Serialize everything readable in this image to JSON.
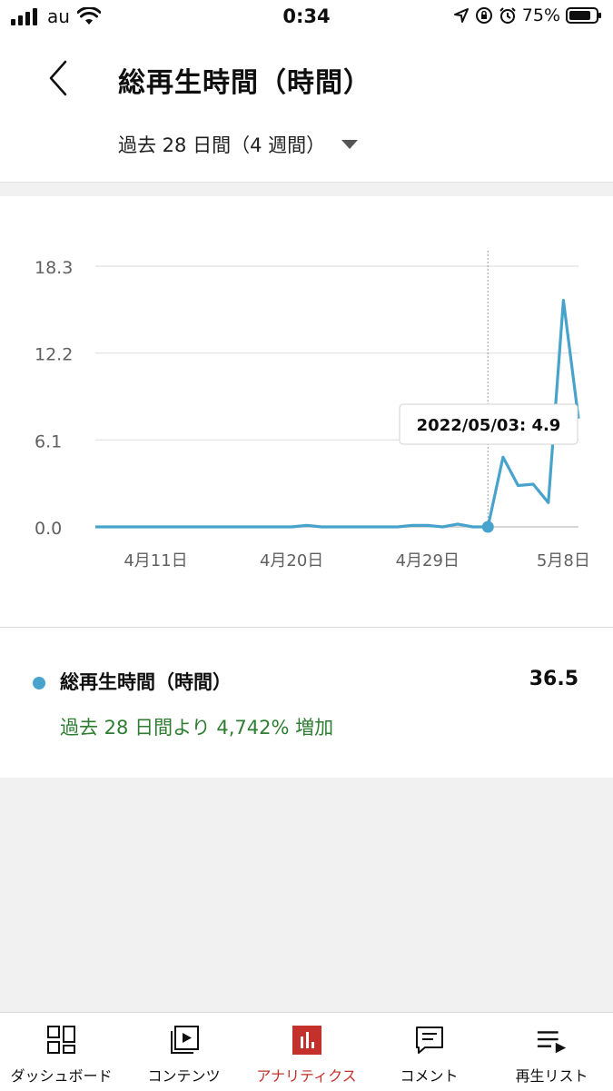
{
  "status_bar": {
    "carrier": "au",
    "time": "0:34",
    "battery": "75%"
  },
  "header": {
    "title": "総再生時間（時間）",
    "period": "過去 28 日間（4 週間）"
  },
  "tooltip": {
    "text": "2022/05/03: 4.9"
  },
  "summary": {
    "metric_label": "総再生時間（時間）",
    "value": "36.5",
    "change": "過去 28 日間より 4,742% 増加"
  },
  "nav": {
    "dashboard": "ダッシュボード",
    "content": "コンテンツ",
    "analytics": "アナリティクス",
    "comments": "コメント",
    "playlists": "再生リスト"
  },
  "colors": {
    "series": "#48a3cc",
    "accent": "#c4302b",
    "positive": "#2e7d32"
  },
  "chart_data": {
    "type": "line",
    "ylim": [
      0,
      18.3
    ],
    "y_ticks": [
      "18.3",
      "12.2",
      "6.1",
      "0.0"
    ],
    "y_tick_values": [
      18.3,
      12.2,
      6.1,
      0
    ],
    "x_tick_labels": [
      "4月11日",
      "4月20日",
      "4月29日",
      "5月8日"
    ],
    "x_tick_indices": [
      4,
      13,
      22,
      31
    ],
    "highlight_index": 26,
    "series": [
      {
        "values": [
          0,
          0,
          0,
          0,
          0,
          0,
          0,
          0,
          0,
          0,
          0,
          0,
          0,
          0,
          0.1,
          0,
          0,
          0,
          0,
          0,
          0,
          0.1,
          0.1,
          0,
          0.2,
          0,
          0,
          4.9,
          2.9,
          3.0,
          1.7,
          15.9,
          7.6
        ]
      }
    ]
  }
}
